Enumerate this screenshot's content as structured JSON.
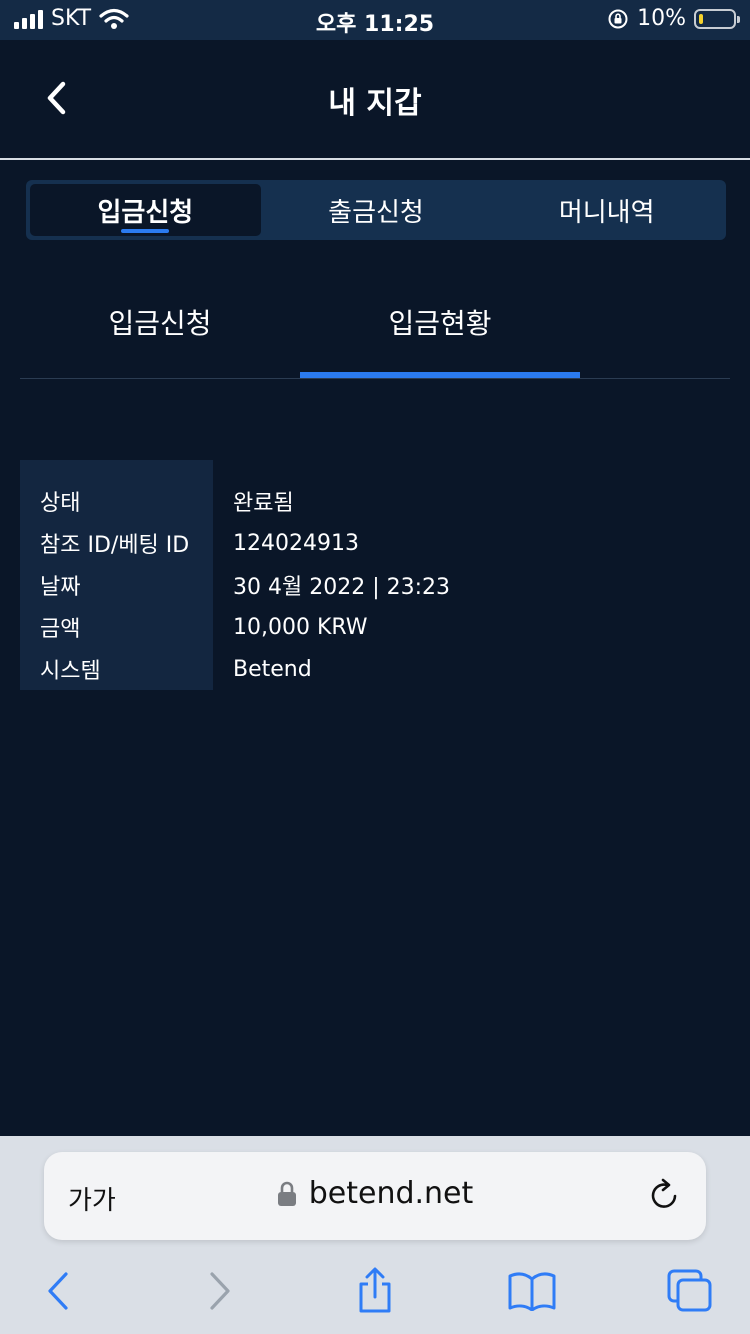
{
  "status_bar": {
    "carrier": "SKT",
    "time": "오후 11:25",
    "battery": "10%",
    "battery_level": 0.1
  },
  "header": {
    "title": "내 지갑"
  },
  "tabs": [
    {
      "label": "입금신청",
      "active": true
    },
    {
      "label": "출금신청",
      "active": false
    },
    {
      "label": "머니내역",
      "active": false
    }
  ],
  "subtabs": [
    {
      "label": "입금신청",
      "active": false
    },
    {
      "label": "입금현황",
      "active": true
    }
  ],
  "details": [
    {
      "label": "상태",
      "value": "완료됨"
    },
    {
      "label": "참조 ID/베팅 ID",
      "value": "124024913"
    },
    {
      "label": "날짜",
      "value": "30 4월 2022 | 23:23"
    },
    {
      "label": "금액",
      "value": "10,000 KRW"
    },
    {
      "label": "시스템",
      "value": "Betend"
    }
  ],
  "browser": {
    "text_size": "가가",
    "url": "betend.net"
  },
  "colors": {
    "background": "#0a1628",
    "accent": "#2b7bf0",
    "panel": "#15304f",
    "browser_icon": "#2f7cf6"
  }
}
